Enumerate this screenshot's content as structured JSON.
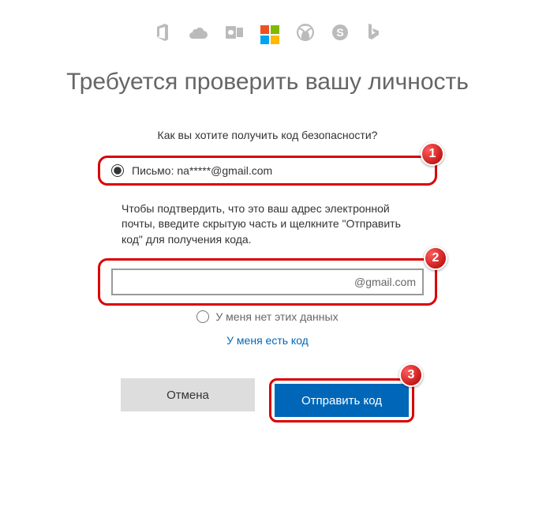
{
  "heading": "Требуется проверить вашу личность",
  "prompt": "Как вы хотите получить код безопасности?",
  "radio_label": "Письмо: na*****@gmail.com",
  "instructions": "Чтобы подтвердить, что это ваш адрес электронной почты, введите скрытую часть и щелкните \"Отправить код\" для получения кода.",
  "email_suffix": "@gmail.com",
  "no_data_label": "У меня нет этих данных",
  "have_code_label": "У меня есть код",
  "cancel_label": "Отмена",
  "send_label": "Отправить код",
  "badges": {
    "one": "1",
    "two": "2",
    "three": "3"
  },
  "icons": [
    "office",
    "onedrive",
    "outlook",
    "microsoft",
    "xbox",
    "skype",
    "bing"
  ]
}
